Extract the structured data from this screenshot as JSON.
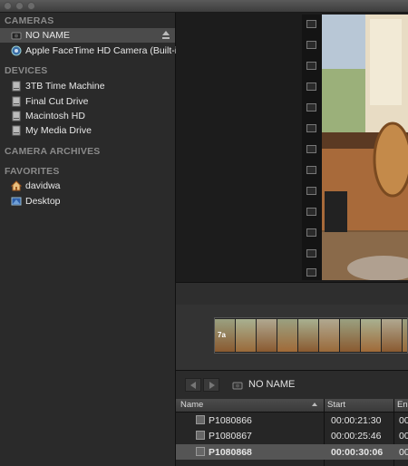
{
  "sidebar": {
    "sections": [
      {
        "title": "CAMERAS",
        "items": [
          {
            "label": "NO NAME",
            "icon": "camera-icon",
            "selected": true,
            "eject": true
          },
          {
            "label": "Apple FaceTime HD Camera (Built-in)",
            "icon": "facetime-camera-icon",
            "selected": false
          }
        ]
      },
      {
        "title": "DEVICES",
        "items": [
          {
            "label": "3TB Time Machine",
            "icon": "hard-drive-icon"
          },
          {
            "label": "Final Cut Drive",
            "icon": "hard-drive-icon"
          },
          {
            "label": "Macintosh HD",
            "icon": "hard-drive-icon"
          },
          {
            "label": "My Media Drive",
            "icon": "hard-drive-icon"
          }
        ]
      },
      {
        "title": "CAMERA ARCHIVES",
        "items": []
      },
      {
        "title": "FAVORITES",
        "items": [
          {
            "label": "davidwa",
            "icon": "home-icon"
          },
          {
            "label": "Desktop",
            "icon": "desktop-icon"
          }
        ]
      }
    ]
  },
  "nav": {
    "title": "NO NAME"
  },
  "clip_thumb_label": "7a",
  "table": {
    "headers": [
      "Name",
      "Start",
      "En"
    ],
    "rows": [
      {
        "name": "P1080866",
        "start": "00:00:21:30",
        "end": "00",
        "selected": false
      },
      {
        "name": "P1080867",
        "start": "00:00:25:46",
        "end": "00",
        "selected": false
      },
      {
        "name": "P1080868",
        "start": "00:00:30:06",
        "end": "00",
        "selected": true
      }
    ]
  },
  "colors": {
    "sidebar_bg": "#2a2a2a",
    "selection": "#4b4b4b",
    "section_title": "#8a8a8a"
  }
}
